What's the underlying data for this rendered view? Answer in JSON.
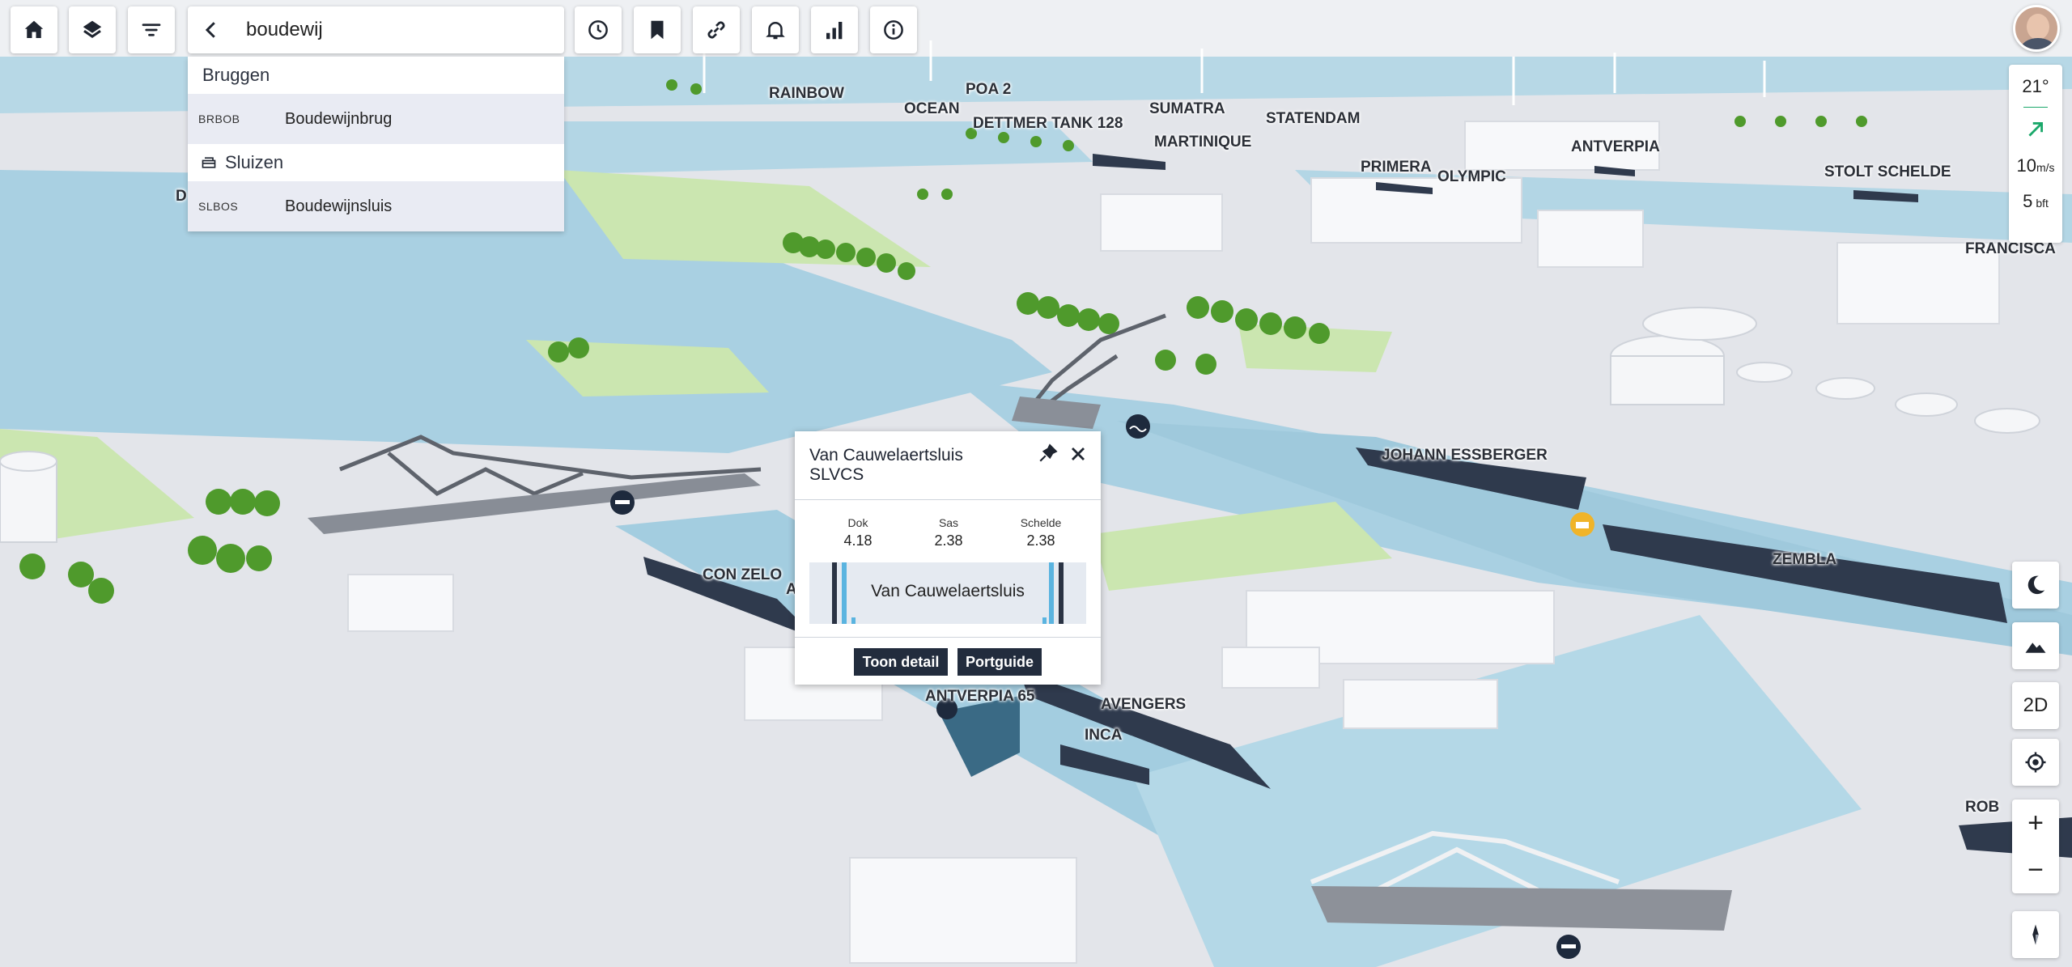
{
  "search": {
    "query": "boudewij",
    "groups": [
      {
        "heading": "Bruggen",
        "items": [
          {
            "code": "BRBOB",
            "name": "Boudewijnbrug"
          }
        ]
      },
      {
        "heading": "Sluizen",
        "items": [
          {
            "code": "SLBOS",
            "name": "Boudewijnsluis"
          }
        ]
      }
    ]
  },
  "toolbar_icons": [
    "home-icon",
    "layers-icon",
    "filter-icon",
    "back-icon",
    "clear-icon",
    "search-icon",
    "history-icon",
    "bookmark-icon",
    "link-icon",
    "bell-icon",
    "stats-icon",
    "info-icon"
  ],
  "weather": {
    "temperature": "21°",
    "wind_speed": "10",
    "wind_unit": "m/s",
    "beaufort": "5",
    "beaufort_unit": "bft"
  },
  "controls": {
    "view_mode": "2D",
    "zoom_in": "+",
    "zoom_out": "−"
  },
  "popup": {
    "title": "Van Cauwelaertsluis",
    "code": "SLVCS",
    "levels": [
      {
        "label": "Dok",
        "value": "4.18"
      },
      {
        "label": "Sas",
        "value": "2.38"
      },
      {
        "label": "Schelde",
        "value": "2.38"
      }
    ],
    "lock_name": "Van Cauwelaertsluis",
    "buttons": {
      "detail": "Toon detail",
      "portguide": "Portguide"
    }
  },
  "map_labels": {
    "rainbow": "RAINBOW",
    "poa2": "POA 2",
    "ocean": "OCEAN",
    "dettmer": "DETTMER TANK 128",
    "sumatra": "SUMATRA",
    "martinique": "MARTINIQUE",
    "statendam": "STATENDAM",
    "antverpia": "ANTVERPIA",
    "primera": "PRIMERA",
    "olympic": "OLYMPIC",
    "stolt": "STOLT SCHELDE",
    "francisca": "FRANCISCA",
    "johann": "JOHANN ESSBERGER",
    "zembla": "ZEMBLA",
    "conzelo": "CON ZELO",
    "antverpia65": "ANTVERPIA 65",
    "avengers": "AVENGERS",
    "inca": "INCA",
    "rob": "ROB",
    "d": "D",
    "a": "A"
  },
  "colors": {
    "water": "#aed3e3",
    "land": "#e3e5ea",
    "grass": "#cbe6b0",
    "tree": "#4f9a2c",
    "ship": "#2f3a4d",
    "button_dark": "#222c3d",
    "accent_green": "#1aa86a"
  }
}
